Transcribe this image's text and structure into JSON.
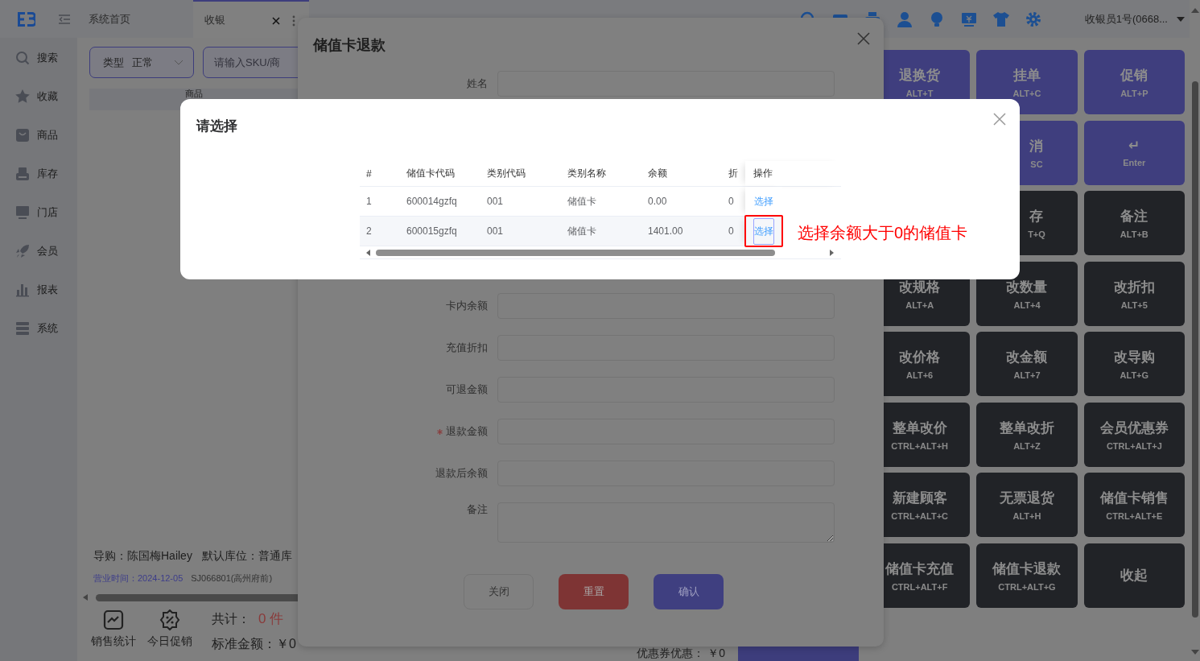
{
  "topbar": {
    "tabs": [
      {
        "label": "系统首页",
        "selected": false,
        "closable": false
      },
      {
        "label": "收银",
        "selected": true,
        "closable": true
      }
    ],
    "user": "收银员1号(0668..."
  },
  "sidebar": [
    {
      "label": "搜索"
    },
    {
      "label": "收藏"
    },
    {
      "label": "商品"
    },
    {
      "label": "库存"
    },
    {
      "label": "门店"
    },
    {
      "label": "会员"
    },
    {
      "label": "报表"
    },
    {
      "label": "系统"
    }
  ],
  "filters": {
    "type_label": "类型",
    "type_value": "正常",
    "search_placeholder": "请输入SKU/商"
  },
  "product_table": {
    "columns": [
      "商品"
    ]
  },
  "info": {
    "guide": "导购：陈国梅Hailey",
    "location": "默认库位：普通库",
    "business_time": "营业时间：2024-12-05",
    "store": "SJ066801(高州府前)"
  },
  "bottom": {
    "tools": [
      {
        "label": "销售统计"
      },
      {
        "label": "今日促销"
      }
    ],
    "total_label": "共计：",
    "total_count": "0 件",
    "standard_label": "标准金额：",
    "standard_value": "￥0",
    "coupon_label": "优惠券优惠：",
    "coupon_value": "￥0"
  },
  "keypad": {
    "columns": [
      [
        {
          "label": "退换货",
          "shortcut": "ALT+T",
          "kind": "accent"
        },
        {
          "label": "改规格",
          "shortcut": "ALT+A",
          "kind": "dark"
        },
        {
          "label": "改价格",
          "shortcut": "ALT+6",
          "kind": "dark"
        },
        {
          "label": "整单改价",
          "shortcut": "CTRL+ALT+H",
          "kind": "dark"
        },
        {
          "label": "新建顾客",
          "shortcut": "CTRL+ALT+C",
          "kind": "dark"
        },
        {
          "label": "储值卡充值",
          "shortcut": "CTRL+ALT+F",
          "kind": "dark"
        }
      ],
      [
        {
          "label": "挂单",
          "shortcut": "ALT+C",
          "kind": "accent"
        },
        {
          "label": "消",
          "shortcut": "SC",
          "kind": "accent"
        },
        {
          "label": "存",
          "shortcut": "T+Q",
          "kind": "dark"
        },
        {
          "label": "改数量",
          "shortcut": "ALT+4",
          "kind": "dark"
        },
        {
          "label": "改金额",
          "shortcut": "ALT+7",
          "kind": "dark"
        },
        {
          "label": "整单改折",
          "shortcut": "ALT+Z",
          "kind": "dark"
        },
        {
          "label": "无票退货",
          "shortcut": "ALT+H",
          "kind": "dark"
        },
        {
          "label": "储值卡退款",
          "shortcut": "CTRL+ALT+G",
          "kind": "dark"
        }
      ],
      [
        {
          "label": "促销",
          "shortcut": "ALT+P",
          "kind": "accent"
        },
        {
          "label": "↵",
          "shortcut": "Enter",
          "kind": "accent"
        },
        {
          "label": "备注",
          "shortcut": "ALT+B",
          "kind": "dark"
        },
        {
          "label": "改折扣",
          "shortcut": "ALT+5",
          "kind": "dark"
        },
        {
          "label": "改导购",
          "shortcut": "ALT+G",
          "kind": "dark"
        },
        {
          "label": "会员优惠券",
          "shortcut": "CTRL+ALT+J",
          "kind": "dark"
        },
        {
          "label": "储值卡销售",
          "shortcut": "CTRL+ALT+E",
          "kind": "dark"
        },
        {
          "label": "收起",
          "kind": "dark"
        }
      ]
    ]
  },
  "refund_dialog": {
    "title": "储值卡退款",
    "name_label": "姓名",
    "fields": [
      {
        "label": "卡内余额",
        "required": false
      },
      {
        "label": "充值折扣",
        "required": false
      },
      {
        "label": "可退金额",
        "required": false
      },
      {
        "label": "退款金额",
        "required": true
      },
      {
        "label": "退款后余额",
        "required": false
      }
    ],
    "remark_label": "备注",
    "buttons": [
      {
        "label": "关闭",
        "kind": "plain"
      },
      {
        "label": "重置",
        "kind": "danger"
      },
      {
        "label": "确认",
        "kind": "primary"
      }
    ]
  },
  "select_dialog": {
    "title": "请选择",
    "columns": [
      "#",
      "储值卡代码",
      "类别代码",
      "类别名称",
      "余额",
      "折",
      "操作"
    ],
    "rows": [
      {
        "cells": [
          "1",
          "600014gzfq",
          "001",
          "储值卡",
          "0.00",
          "0"
        ],
        "action": "选择",
        "highlighted": false,
        "annotated": false
      },
      {
        "cells": [
          "2",
          "600015gzfq",
          "001",
          "储值卡",
          "1401.00",
          "0"
        ],
        "action": "选择",
        "highlighted": true,
        "annotated": true
      }
    ],
    "annotation": "选择余额大于0的储值卡"
  }
}
